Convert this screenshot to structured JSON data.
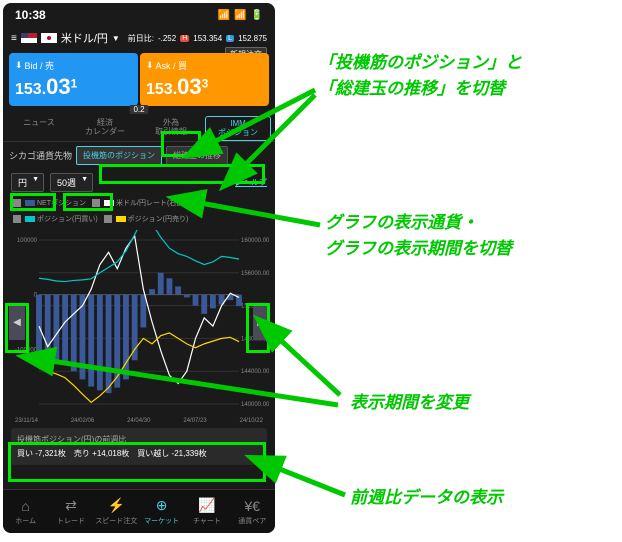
{
  "status": {
    "time": "10:38"
  },
  "header": {
    "pair": "米ドル/円",
    "prev_label": "前日比:",
    "prev_change": "-.252",
    "high_label": "H",
    "high": "153.354",
    "low_label": "L",
    "low": "152.875"
  },
  "prices": {
    "new_order": "新規注文",
    "bid_label": "Bid / 売",
    "ask_label": "Ask / 買",
    "bid_int": "153.",
    "bid_big": "03",
    "bid_sup": "1",
    "ask_int": "153.",
    "ask_big": "03",
    "ask_sup": "3",
    "spread": "0.2"
  },
  "tabs": {
    "t1": "ニュース",
    "t2": "経済\nカレンダー",
    "t3": "外為\n取引情報",
    "t4": "IMM\nポジション"
  },
  "sub": {
    "title": "シカゴ通貨先物",
    "seg1": "投機筋のポジション",
    "seg2": "総建玉の推移"
  },
  "filters": {
    "currency": "円",
    "period": "50週",
    "help": "ヘルプ"
  },
  "legend": {
    "l1": "NETポジション",
    "l2": "米ドル/円レート(右目盛)",
    "l3": "ポジション(円買い)",
    "l4": "ポジション(円売り)"
  },
  "chart_data": {
    "type": "bar+line",
    "x_labels": [
      "23/11/14",
      "24/02/06",
      "24/04/30",
      "24/07/23",
      "24/10/22"
    ],
    "left_axis": {
      "min": -200000,
      "max": 100000,
      "ticks": [
        100000,
        0,
        -100000
      ]
    },
    "right_axis": {
      "min": 140000,
      "max": 160000,
      "ticks": [
        160000,
        156000,
        152000,
        148000,
        144000,
        140000
      ]
    },
    "series": [
      {
        "name": "NETポジション",
        "type": "bar",
        "color": "#3b5998",
        "values": [
          -105000,
          -112000,
          -120000,
          -128000,
          -140000,
          -155000,
          -168000,
          -175000,
          -180000,
          -170000,
          -155000,
          -120000,
          -60000,
          10000,
          40000,
          30000,
          15000,
          -5000,
          -20000,
          -35000,
          -25000,
          -18000,
          -10000,
          -21000
        ]
      },
      {
        "name": "米ドル/円レート",
        "type": "line",
        "color": "#ffffff",
        "axis": "right",
        "values": [
          149500,
          147000,
          148500,
          150000,
          151000,
          152000,
          154000,
          157000,
          158500,
          156500,
          159000,
          160500,
          154000,
          150000,
          146500,
          143500,
          142500,
          144000,
          148000,
          150500,
          149500,
          152000,
          153500,
          153000
        ]
      },
      {
        "name": "ポジション(円買い)",
        "type": "line",
        "color": "#00c8c8",
        "values": [
          30000,
          28000,
          25000,
          24000,
          26000,
          27000,
          29000,
          40000,
          50000,
          60000,
          80000,
          110000,
          140000,
          130000,
          105000,
          85000,
          75000,
          70000,
          62000,
          55000,
          60000,
          70000,
          68000,
          65000
        ]
      },
      {
        "name": "ポジション(円売り)",
        "type": "line",
        "color": "#ffd700",
        "values": [
          -135000,
          -140000,
          -145000,
          -152000,
          -166000,
          -182000,
          -197000,
          -185000,
          -170000,
          -150000,
          -125000,
          -100000,
          -80000,
          -90000,
          -75000,
          -70000,
          -80000,
          -90000,
          -97000,
          -90000,
          -85000,
          -80000,
          -78000,
          -86000
        ]
      }
    ]
  },
  "summary": {
    "title": "投機筋ポジション(円)の前週比",
    "buy_label": "買い",
    "buy": "-7,321枚",
    "sell_label": "売り",
    "sell": "+14,018枚",
    "net_label": "買い越し",
    "net": "-21,339枚"
  },
  "bottom_nav": {
    "n1": "ホーム",
    "n2": "トレード",
    "n3": "スピード注文",
    "n4": "マーケット",
    "n5": "チャート",
    "n6": "通貨ペア"
  },
  "annotations": {
    "a1": "「投機筋のポジション」と\n「総建玉の推移」を切替",
    "a2": "グラフの表示通貨・\nグラフの表示期間を切替",
    "a3": "表示期間を変更",
    "a4": "前週比データの表示"
  }
}
